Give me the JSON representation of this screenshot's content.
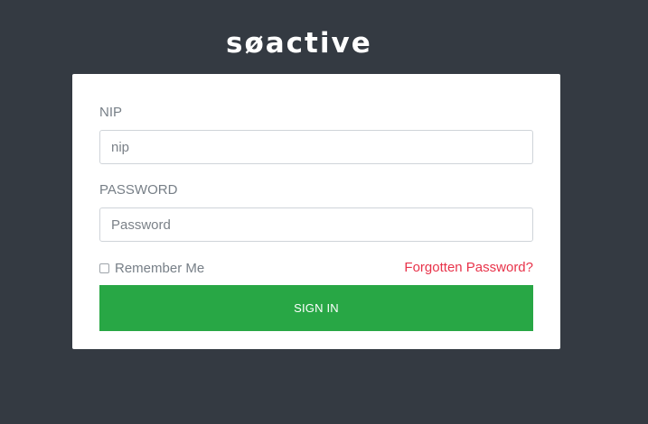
{
  "brand": {
    "logo_text": "søactive"
  },
  "form": {
    "nip_label": "NIP",
    "nip_placeholder": "nip",
    "password_label": "PASSWORD",
    "password_placeholder": "Password",
    "remember_label": "Remember Me",
    "forgot_label": "Forgotten Password?",
    "submit_label": "SIGN IN"
  },
  "colors": {
    "background": "#343a42",
    "card": "#ffffff",
    "primary_button": "#28a745",
    "link": "#e8334a"
  }
}
